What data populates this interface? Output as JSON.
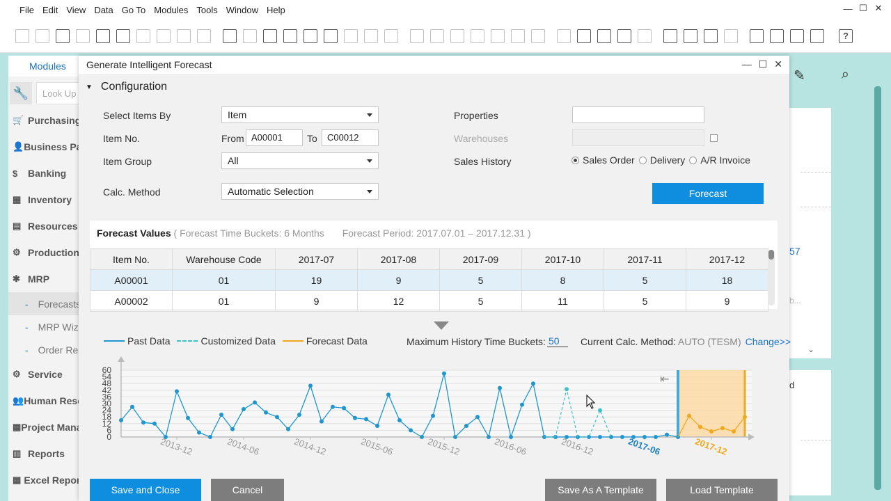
{
  "menu": [
    "File",
    "Edit",
    "View",
    "Data",
    "Go To",
    "Modules",
    "Tools",
    "Window",
    "Help"
  ],
  "window_controls": {
    "minimize": "—",
    "maximize": "☐",
    "close": "✕"
  },
  "left_panel": {
    "tab": "Modules",
    "lookup_placeholder": "Look Up",
    "modules": [
      {
        "icon": "🛒",
        "label": "Purchasing"
      },
      {
        "icon": "👤",
        "label": "Business Partners"
      },
      {
        "icon": "$",
        "label": "Banking"
      },
      {
        "icon": "▦",
        "label": "Inventory"
      },
      {
        "icon": "▤",
        "label": "Resources"
      },
      {
        "icon": "⚙",
        "label": "Production"
      },
      {
        "icon": "✱",
        "label": "MRP"
      }
    ],
    "sub_items": [
      {
        "label": "Forecasts",
        "active": true
      },
      {
        "label": "MRP Wizard",
        "active": false
      },
      {
        "label": "Order Recommendation",
        "active": false
      }
    ],
    "modules_after": [
      {
        "icon": "⚙",
        "label": "Service"
      },
      {
        "icon": "👥",
        "label": "Human Resources"
      },
      {
        "icon": "▦",
        "label": "Project Management"
      },
      {
        "icon": "▥",
        "label": "Reports"
      },
      {
        "icon": "▦",
        "label": "Excel Report"
      }
    ]
  },
  "right_peek": {
    "text1": "57",
    "text2": "b...",
    "text3": "d"
  },
  "dialog": {
    "title": "Generate Intelligent Forecast",
    "config_title": "Configuration",
    "labels": {
      "select_items_by": "Select Items By",
      "item_no": "Item No.",
      "from": "From",
      "to": "To",
      "item_group": "Item Group",
      "calc_method": "Calc. Method",
      "properties": "Properties",
      "warehouses": "Warehouses",
      "sales_history": "Sales History"
    },
    "values": {
      "select_items_by": "Item",
      "item_from": "A00001",
      "item_to": "C00012",
      "item_group": "All",
      "calc_method": "Automatic Selection",
      "properties": "",
      "warehouses": ""
    },
    "sales_history_options": [
      {
        "label": "Sales Order",
        "selected": true
      },
      {
        "label": "Delivery",
        "selected": false
      },
      {
        "label": "A/R Invoice",
        "selected": false
      }
    ],
    "forecast_button": "Forecast",
    "forecast_values": {
      "title": "Forecast Values",
      "time_buckets": "( Forecast Time Buckets: 6 Months",
      "period": "Forecast Period: 2017.07.01 – 2017.12.31 )",
      "columns": [
        "Item No.",
        "Warehouse Code",
        "2017-07",
        "2017-08",
        "2017-09",
        "2017-10",
        "2017-11",
        "2017-12"
      ],
      "rows": [
        [
          "A00001",
          "01",
          "19",
          "9",
          "5",
          "8",
          "5",
          "18"
        ],
        [
          "A00002",
          "01",
          "9",
          "12",
          "5",
          "11",
          "5",
          "9"
        ]
      ]
    },
    "legend": {
      "past": "Past Data",
      "custom": "Customized Data",
      "forecast": "Forecast Data"
    },
    "history": {
      "label": "Maximum History Time Buckets:",
      "value": "50",
      "calc_label": "Current Calc. Method:",
      "calc_value": "AUTO (TESM)",
      "change": "Change>>"
    },
    "buttons": {
      "save_close": "Save and Close",
      "cancel": "Cancel",
      "save_template": "Save As A Template",
      "load_template": "Load Template"
    }
  },
  "chart_data": {
    "type": "line",
    "y_ticks": [
      "0",
      "6",
      "12",
      "18",
      "24",
      "30",
      "36",
      "42",
      "48",
      "54",
      "60"
    ],
    "ylim": [
      0,
      60
    ],
    "x_tick_labels": [
      "2013-12",
      "2014-06",
      "2014-12",
      "2015-06",
      "2015-12",
      "2016-06",
      "2016-12",
      "2017-06",
      "2017-12"
    ],
    "past": [
      15,
      27,
      13,
      12,
      0,
      41,
      17,
      4,
      0,
      20,
      7,
      25,
      31,
      22,
      18,
      7,
      20,
      46,
      14,
      27,
      26,
      17,
      16,
      10,
      38,
      15,
      6,
      0,
      19,
      57,
      0,
      10,
      18,
      0,
      44,
      0,
      29,
      48,
      0,
      0,
      0,
      0,
      0,
      0,
      0,
      0,
      0,
      0,
      0,
      2,
      0
    ],
    "customized": [
      {
        "i": 38,
        "v": 0
      },
      {
        "i": 39,
        "v": 0
      },
      {
        "i": 40,
        "v": 43
      },
      {
        "i": 41,
        "v": 0
      },
      {
        "i": 42,
        "v": 0
      },
      {
        "i": 43,
        "v": 24
      },
      {
        "i": 44,
        "v": 0
      }
    ],
    "forecast": [
      19,
      9,
      5,
      8,
      5,
      18
    ],
    "colors": {
      "past": "#1f96cf",
      "custom": "#3cc1c8",
      "forecast": "#f0a81e",
      "band": "#fbdcaa"
    }
  }
}
